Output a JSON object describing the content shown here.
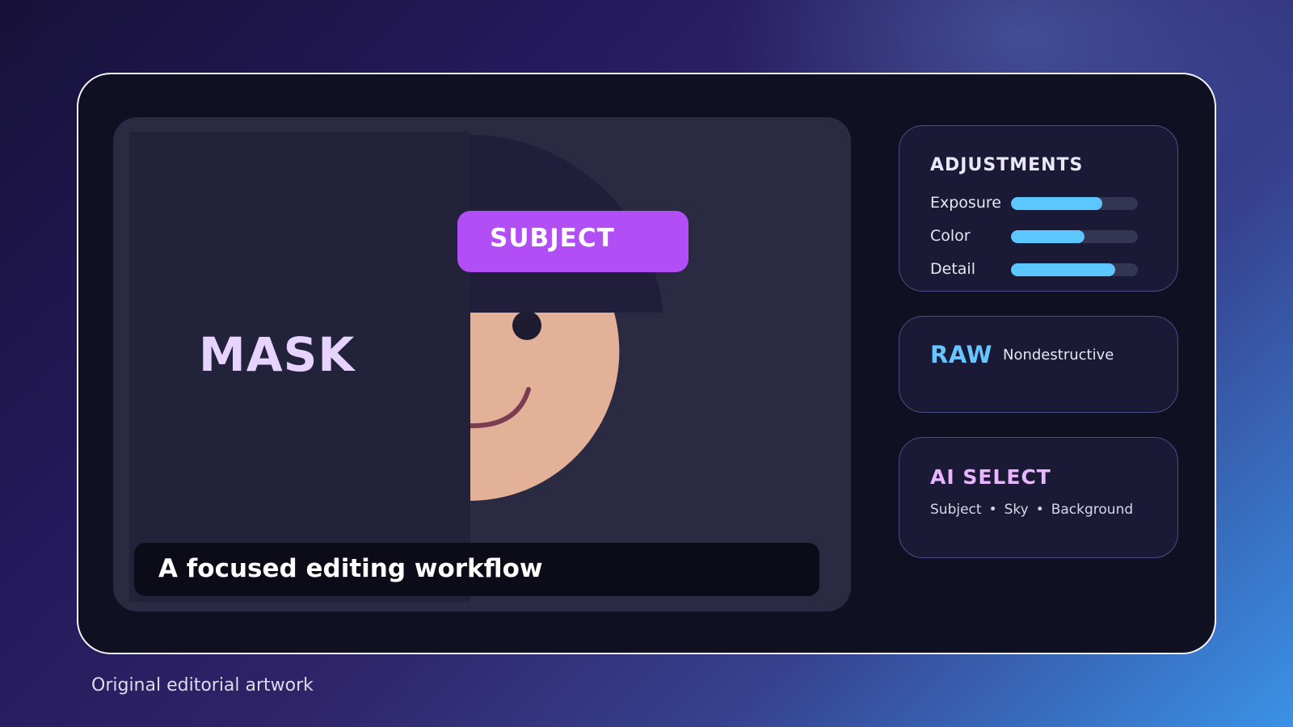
{
  "preview": {
    "mask_label": "MASK",
    "subject_tag": "SUBJECT",
    "caption": "A focused editing workflow"
  },
  "adjustments": {
    "title": "ADJUSTMENTS",
    "sliders": [
      {
        "label": "Exposure",
        "value": 0.72
      },
      {
        "label": "Color",
        "value": 0.58
      },
      {
        "label": "Detail",
        "value": 0.82
      }
    ]
  },
  "raw": {
    "title": "RAW",
    "subtitle": "Nondestructive"
  },
  "ai_select": {
    "title": "AI SELECT",
    "options": [
      "Subject",
      "Sky",
      "Background"
    ],
    "separator": "•"
  },
  "footer": "Original editorial artwork",
  "colors": {
    "accent_purple": "#b24ef5",
    "accent_blue": "#5cc6ff",
    "mask_text": "#e6d3ff",
    "ai_title": "#e8b6ff"
  }
}
